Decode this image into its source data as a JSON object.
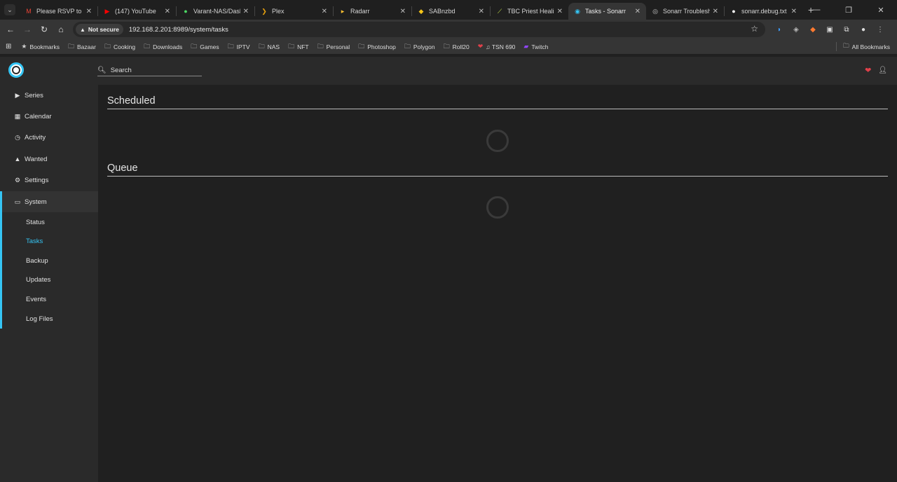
{
  "browser": {
    "tabs": [
      {
        "title": "Please RSVP to HC",
        "favicon": "gmail-icon",
        "color": "#ea4335"
      },
      {
        "title": "(147) YouTube",
        "favicon": "youtube-icon",
        "color": "#ff0000"
      },
      {
        "title": "Varant-NAS/Dashb",
        "favicon": "dot-icon",
        "color": "#4cd964"
      },
      {
        "title": "Plex",
        "favicon": "plex-icon",
        "color": "#e5a00d"
      },
      {
        "title": "Radarr",
        "favicon": "radarr-icon",
        "color": "#ffc230"
      },
      {
        "title": "SABnzbd",
        "favicon": "sabnzbd-icon",
        "color": "#f5c518"
      },
      {
        "title": "TBC Priest Healing",
        "favicon": "wand-icon",
        "color": "#c4e34a"
      },
      {
        "title": "Tasks - Sonarr",
        "favicon": "sonarr-icon",
        "color": "#35c5f4"
      },
      {
        "title": "Sonarr Troubleshoo",
        "favicon": "sonarr-icon",
        "color": "#cccccc"
      },
      {
        "title": "sonarr.debug.txt",
        "favicon": "github-icon",
        "color": "#ffffff"
      }
    ],
    "active_tab": 7,
    "security_label": "Not secure",
    "url": "192.168.2.201:8989/system/tasks",
    "bookmarks": [
      "Bookmarks",
      "Bazaar",
      "Cooking",
      "Downloads",
      "Games",
      "IPTV",
      "NAS",
      "NFT",
      "Personal",
      "Photoshop",
      "Polygon",
      "Roll20",
      "♫ TSN 690",
      "Twitch"
    ],
    "all_bookmarks": "All Bookmarks"
  },
  "app": {
    "search_placeholder": "Search",
    "accent_color": "#35c5f4",
    "nav": [
      {
        "label": "Series",
        "icon": "play-icon"
      },
      {
        "label": "Calendar",
        "icon": "calendar-icon"
      },
      {
        "label": "Activity",
        "icon": "clock-icon"
      },
      {
        "label": "Wanted",
        "icon": "warning-icon"
      },
      {
        "label": "Settings",
        "icon": "cogs-icon"
      },
      {
        "label": "System",
        "icon": "laptop-icon"
      }
    ],
    "system_sub": [
      "Status",
      "Tasks",
      "Backup",
      "Updates",
      "Events",
      "Log Files"
    ],
    "current_sub": "Tasks"
  },
  "main": {
    "scheduled_title": "Scheduled",
    "queue_title": "Queue"
  }
}
